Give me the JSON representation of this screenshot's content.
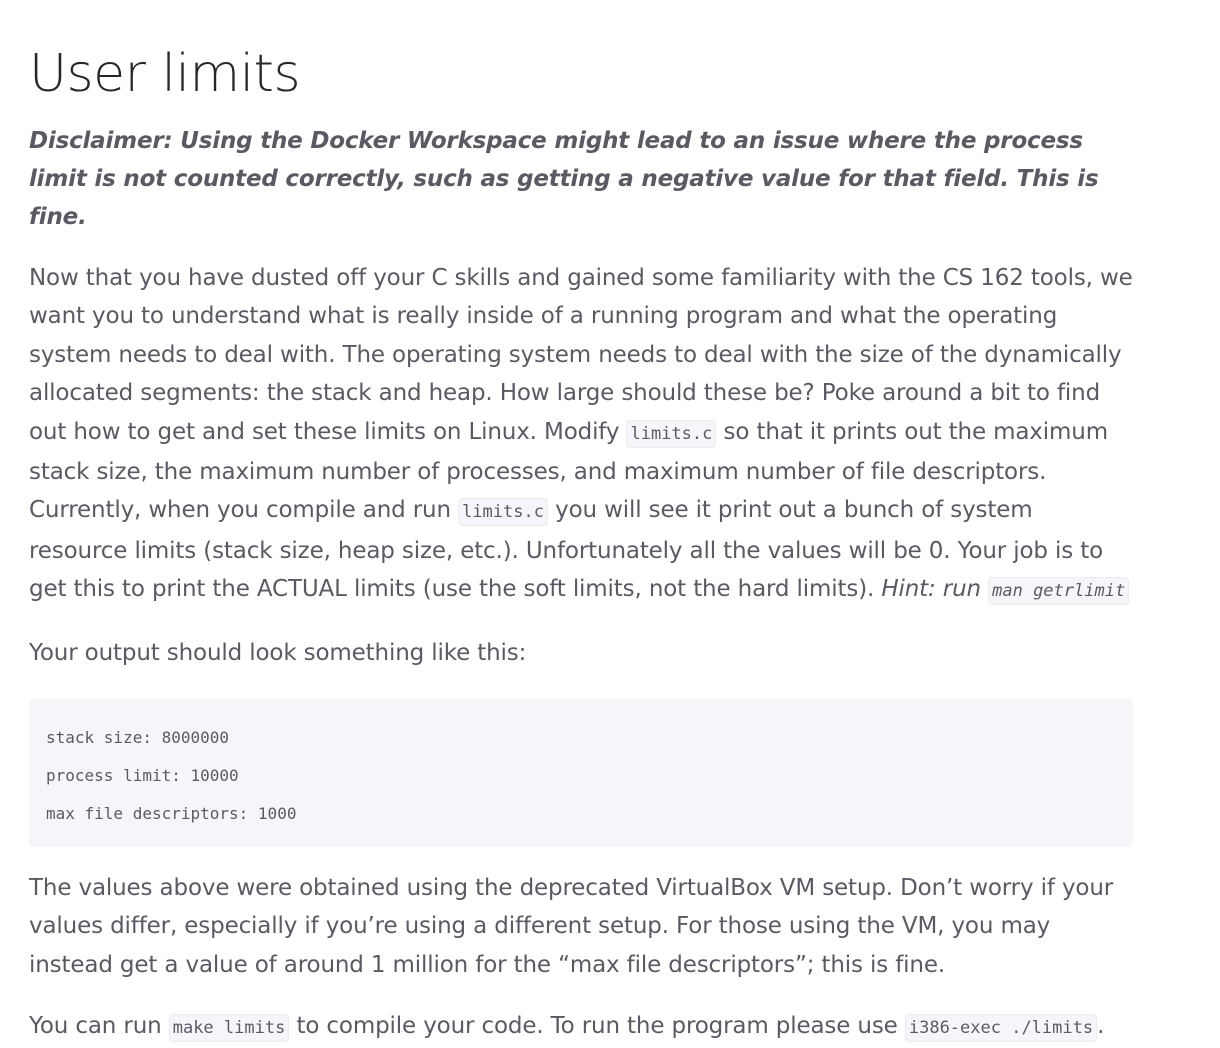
{
  "title": "User limits",
  "disclaimer": "Disclaimer: Using the Docker Workspace might lead to an issue where the process limit is not counted correctly, such as getting a negative value for that field. This is fine.",
  "intro": {
    "part1": "Now that you have dusted off your C skills and gained some familiarity with the CS 162 tools, we want you to understand what is really inside of a running program and what the operating system needs to deal with. The operating system needs to deal with the size of the dynamically allocated segments: the stack and heap. How large should these be? Poke around a bit to find out how to get and set these limits on Linux. Modify ",
    "code1": "limits.c",
    "part2": " so that it prints out the maximum stack size, the maximum number of processes, and maximum number of file descriptors. Currently, when you compile and run ",
    "code2": "limits.c",
    "part3": " you will see it print out a bunch of system resource limits (stack size, heap size, etc.). Unfortunately all the values will be 0. Your job is to get this to print the ACTUAL limits (use the soft limits, not the hard limits). ",
    "hint_text": "Hint: run ",
    "hint_code": "man getrlimit"
  },
  "output_intro": "Your output should look something like this:",
  "output_lines": [
    "stack size: 8000000",
    "process limit: 10000",
    "max file descriptors: 1000"
  ],
  "values_note": "The values above were obtained using the deprecated VirtualBox VM setup. Don’t worry if your values differ, especially if you’re using a different setup. For those using the VM, you may instead get a value of around 1 million for the “max file descriptors”; this is fine.",
  "run_note": {
    "part1": "You can run ",
    "code1": "make limits",
    "part2": " to compile your code. To run the program please use ",
    "code2": "i386-exec ./limits",
    "part3": "."
  },
  "colors": {
    "heading": "#27262b",
    "body_text": "#5c5962",
    "code_background": "#f5f6fa",
    "code_border": "#eeebee"
  }
}
